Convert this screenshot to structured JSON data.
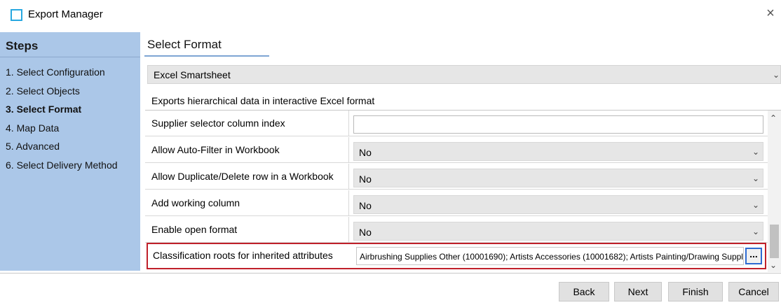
{
  "window": {
    "title": "Export Manager",
    "title_icon": "app-window-icon",
    "close_icon": "close-icon",
    "close_glyph": "×"
  },
  "sidebar": {
    "title": "Steps",
    "items": [
      {
        "label": "1. Select Configuration",
        "active": false
      },
      {
        "label": "2. Select Objects",
        "active": false
      },
      {
        "label": "3. Select Format",
        "active": true
      },
      {
        "label": "4. Map Data",
        "active": false
      },
      {
        "label": "5. Advanced",
        "active": false
      },
      {
        "label": "6. Select Delivery Method",
        "active": false
      }
    ]
  },
  "main": {
    "section_title": "Select Format",
    "format": {
      "selected": "Excel Smartsheet"
    },
    "description": "Exports hierarchical data in interactive Excel format",
    "properties": [
      {
        "label": "Supplier selector column index",
        "type": "text",
        "value": ""
      },
      {
        "label": "Allow Auto-Filter in Workbook",
        "type": "dropdown",
        "value": "No"
      },
      {
        "label": "Allow Duplicate/Delete row in a Workbook",
        "type": "dropdown",
        "value": "No"
      },
      {
        "label": "Add working column",
        "type": "dropdown",
        "value": "No"
      },
      {
        "label": "Enable open format",
        "type": "dropdown",
        "value": "No"
      },
      {
        "label": "Classification roots for inherited attributes",
        "type": "picker",
        "value": "Airbrushing Supplies Other (10001690); Artists Accessories (10001682); Artists Painting/Drawing Supplies",
        "button_label": "..."
      }
    ]
  },
  "footer": {
    "back_label": "Back",
    "next_label": "Next",
    "finish_label": "Finish",
    "cancel_label": "Cancel"
  },
  "colors": {
    "sidebar_bg": "#abc7e8",
    "highlight_border": "#c0202a",
    "accent": "#28a8e0"
  }
}
